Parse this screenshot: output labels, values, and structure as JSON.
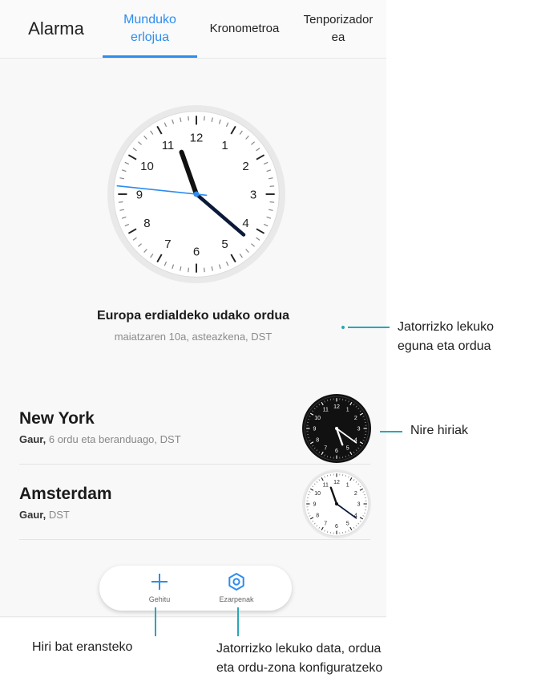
{
  "tabs": [
    {
      "label": "Alarma",
      "active": false
    },
    {
      "label_line1": "Munduko",
      "label_line2": "erlojua",
      "active": true
    },
    {
      "label": "Kronometroa",
      "active": false
    },
    {
      "label_line1": "Tenporizador",
      "label_line2": "ea",
      "active": false
    }
  ],
  "local": {
    "zone_name": "Europa erdialdeko udako ordua",
    "date_line": "maiatzaren 10a, asteazkena, DST",
    "clock_numbers": [
      "12",
      "1",
      "2",
      "3",
      "4",
      "5",
      "6",
      "7",
      "8",
      "9",
      "10",
      "11"
    ],
    "time": {
      "hour": 11,
      "minute": 21,
      "second": 46
    }
  },
  "cities": [
    {
      "name": "New York",
      "day": "Gaur,",
      "offset": " 6 ordu eta  beranduago, DST",
      "theme": "dark",
      "time": {
        "hour": 5,
        "minute": 21
      }
    },
    {
      "name": "Amsterdam",
      "day": "Gaur,",
      "offset": " DST",
      "theme": "light",
      "time": {
        "hour": 11,
        "minute": 21
      }
    }
  ],
  "actions": {
    "add_label": "Gehitu",
    "settings_label": "Ezarpenak"
  },
  "callouts": {
    "local_line1": "Jatorrizko lekuko",
    "local_line2": "eguna eta ordua",
    "cities": "Nire hiriak",
    "add": "Hiri bat eransteko",
    "settings_line1": "Jatorrizko lekuko data, ordua",
    "settings_line2": "eta ordu-zona konfiguratzeko"
  },
  "colors": {
    "accent": "#2d8cf0",
    "callout": "#2aa7b7"
  }
}
